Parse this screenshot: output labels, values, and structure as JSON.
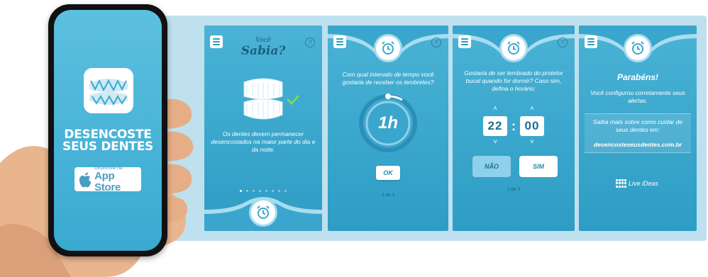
{
  "colors": {
    "screen_top": "#4ab3d6",
    "screen_bottom": "#2e9cc4",
    "strip": "#bfe0ee",
    "dark_text": "#1d5f80",
    "accent_check": "#7ed957"
  },
  "phone": {
    "title_line1": "DESENCOSTE",
    "title_line2": "SEUS DENTES",
    "store_small": "Disponível na",
    "store_big": "App Store",
    "icons": [
      "teeth-icon",
      "apple-icon"
    ]
  },
  "screen1": {
    "voce": "Você",
    "sabia": "Sabia?",
    "help": "?",
    "body": "Os dentes devem permanecer desencostados na maior parte do dia e da noite.",
    "dots_total": 8,
    "dots_active": 1
  },
  "screen2": {
    "help": "?",
    "question": "Com qual intervalo de tempo você gostaria de receber os lembretes?",
    "interval": "1h",
    "ok_label": "OK",
    "page": "1 de 3"
  },
  "screen3": {
    "help": "?",
    "question": "Gostaria de ser lembrado do protetor bucal quando for dormir? Caso sim, defina o horário:",
    "hour": "22",
    "minute": "00",
    "colon": ":",
    "no_label": "NÃO",
    "yes_label": "SIM",
    "page": "2 de 3"
  },
  "screen4": {
    "congrats": "Parabéns!",
    "configured": "Você configurou corretamente seus alertas.",
    "saiba": "Saiba mais sobre como cuidar de seus dentes em:",
    "link": "desencosteseusdentes.com.br",
    "brand": "Live iDeas"
  }
}
